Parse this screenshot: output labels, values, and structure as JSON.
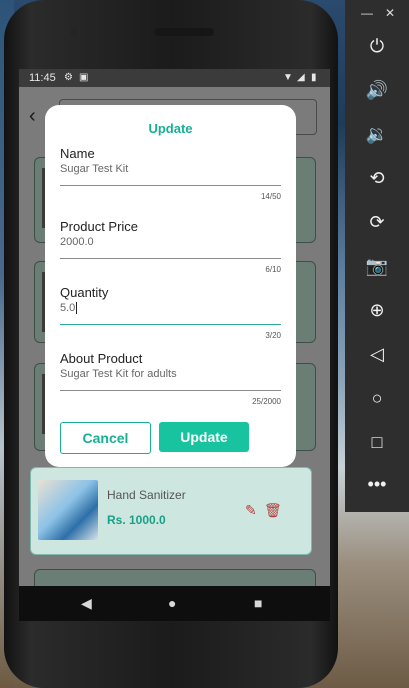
{
  "status_bar": {
    "time": "11:45",
    "left_icons": [
      "gear-icon",
      "image-icon"
    ],
    "right_icons": [
      "wifi-icon",
      "signal-icon",
      "battery-icon"
    ]
  },
  "background_card": {
    "title": "Hand Sanitizer",
    "price": "Rs. 1000.0"
  },
  "dialog": {
    "title": "Update",
    "fields": [
      {
        "label": "Name",
        "value": "Sugar Test Kit",
        "counter": "14/50"
      },
      {
        "label": "Product Price",
        "value": "2000.0",
        "counter": "6/10"
      },
      {
        "label": "Quantity",
        "value": "5.0",
        "counter": "3/20"
      },
      {
        "label": "About Product",
        "value": "Sugar Test Kit for adults",
        "counter": "25/2000"
      }
    ],
    "cancel_label": "Cancel",
    "update_label": "Update"
  },
  "colors": {
    "accent": "#17b094",
    "button": "#17c49f",
    "delete": "#b23b3b"
  },
  "emulator_panel": {
    "window_controls": [
      "minimize-icon",
      "close-icon"
    ],
    "controls": [
      "power-icon",
      "volume-up-icon",
      "volume-down-icon",
      "rotate-left-icon",
      "rotate-right-icon",
      "camera-icon",
      "zoom-icon",
      "back-icon",
      "home-icon",
      "overview-icon",
      "more-icon"
    ]
  }
}
